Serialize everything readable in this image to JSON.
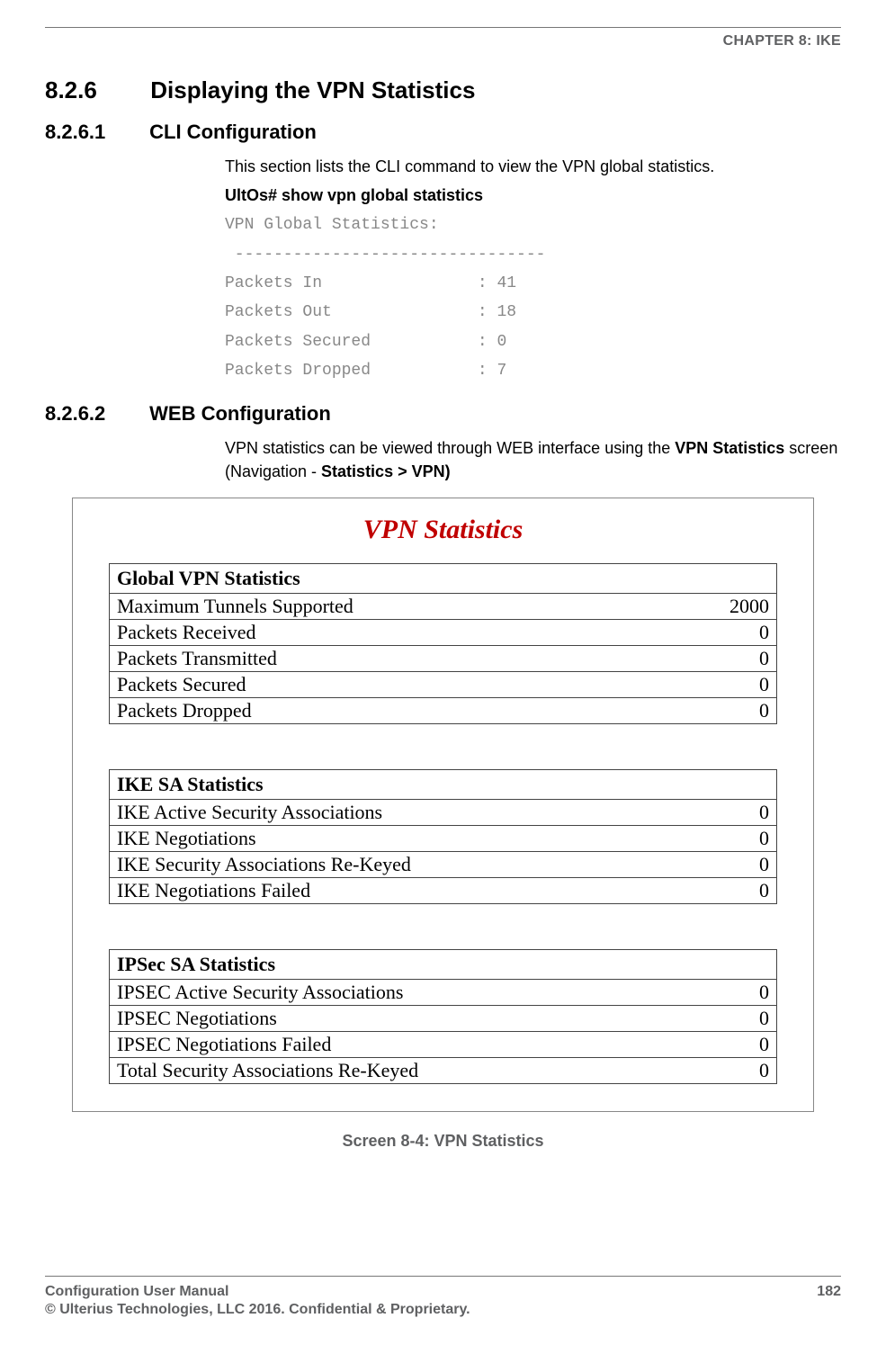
{
  "header": {
    "chapter": "CHAPTER 8: IKE"
  },
  "section": {
    "number": "8.2.6",
    "title": "Displaying the VPN Statistics"
  },
  "sub1": {
    "number": "8.2.6.1",
    "title": "CLI Configuration",
    "intro": "This section lists the CLI command to view the VPN global statistics.",
    "command": "UltOs# show vpn global statistics",
    "cli_output": "VPN Global Statistics:\n --------------------------------\nPackets In                : 41\nPackets Out               : 18\nPackets Secured           : 0\nPackets Dropped           : 7"
  },
  "sub2": {
    "number": "8.2.6.2",
    "title": "WEB Configuration",
    "para_pre": "VPN statistics can be viewed through WEB interface using the ",
    "para_bold1": "VPN Statistics",
    "para_mid": " screen (Navigation - ",
    "para_bold2": "Statistics > VPN)"
  },
  "figure": {
    "title": "VPN Statistics",
    "caption": "Screen 8-4: VPN Statistics",
    "blocks": [
      {
        "header": "Global VPN Statistics",
        "rows": [
          {
            "label": "Maximum Tunnels Supported",
            "value": "2000"
          },
          {
            "label": "Packets Received",
            "value": "0"
          },
          {
            "label": "Packets Transmitted",
            "value": "0"
          },
          {
            "label": "Packets Secured",
            "value": "0"
          },
          {
            "label": "Packets Dropped",
            "value": "0"
          }
        ]
      },
      {
        "header": "IKE SA Statistics",
        "rows": [
          {
            "label": "IKE Active Security Associations",
            "value": "0"
          },
          {
            "label": "IKE Negotiations",
            "value": "0"
          },
          {
            "label": "IKE Security Associations Re-Keyed",
            "value": "0"
          },
          {
            "label": "IKE Negotiations Failed",
            "value": "0"
          }
        ]
      },
      {
        "header": "IPSec SA Statistics",
        "rows": [
          {
            "label": "IPSEC Active Security Associations",
            "value": "0"
          },
          {
            "label": "IPSEC Negotiations",
            "value": "0"
          },
          {
            "label": "IPSEC Negotiations Failed",
            "value": "0"
          },
          {
            "label": "Total Security Associations Re-Keyed",
            "value": "0"
          }
        ]
      }
    ]
  },
  "footer": {
    "left": "Configuration User Manual",
    "page": "182",
    "copyright": "© Ulterius Technologies, LLC 2016. Confidential & Proprietary."
  }
}
